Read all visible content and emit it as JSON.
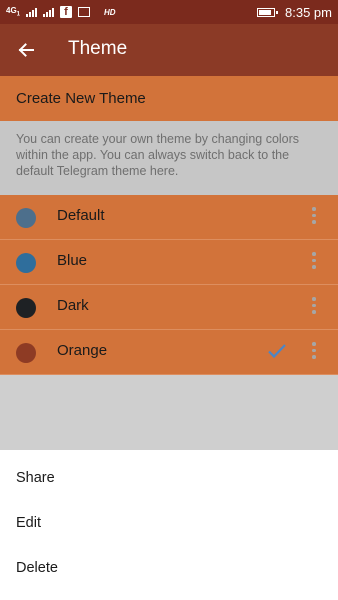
{
  "status_bar": {
    "network": "4G",
    "net_sub": "1",
    "hd_label": "HD",
    "time": "8:35 pm",
    "fb_icon": "facebook-icon",
    "image_icon": "image-icon"
  },
  "app_bar": {
    "title": "Theme",
    "back_icon": "arrow-back-icon"
  },
  "create_theme_label": "Create New Theme",
  "info_text": "You can create your own theme by changing colors within the app. You can always switch back to the default Telegram theme here.",
  "themes": [
    {
      "name": "Default",
      "color": "#4d6f8c",
      "selected": false
    },
    {
      "name": "Blue",
      "color": "#2f6e9c",
      "selected": false
    },
    {
      "name": "Dark",
      "color": "#1e2124",
      "selected": false
    },
    {
      "name": "Orange",
      "color": "#8e3b24",
      "selected": true
    }
  ],
  "colors": {
    "status_bar": "#7b2a1d",
    "app_bar": "#8b3a26",
    "row_bg": "#d2733a",
    "check": "#4a86c8"
  },
  "sheet": {
    "items": [
      "Share",
      "Edit",
      "Delete"
    ]
  }
}
